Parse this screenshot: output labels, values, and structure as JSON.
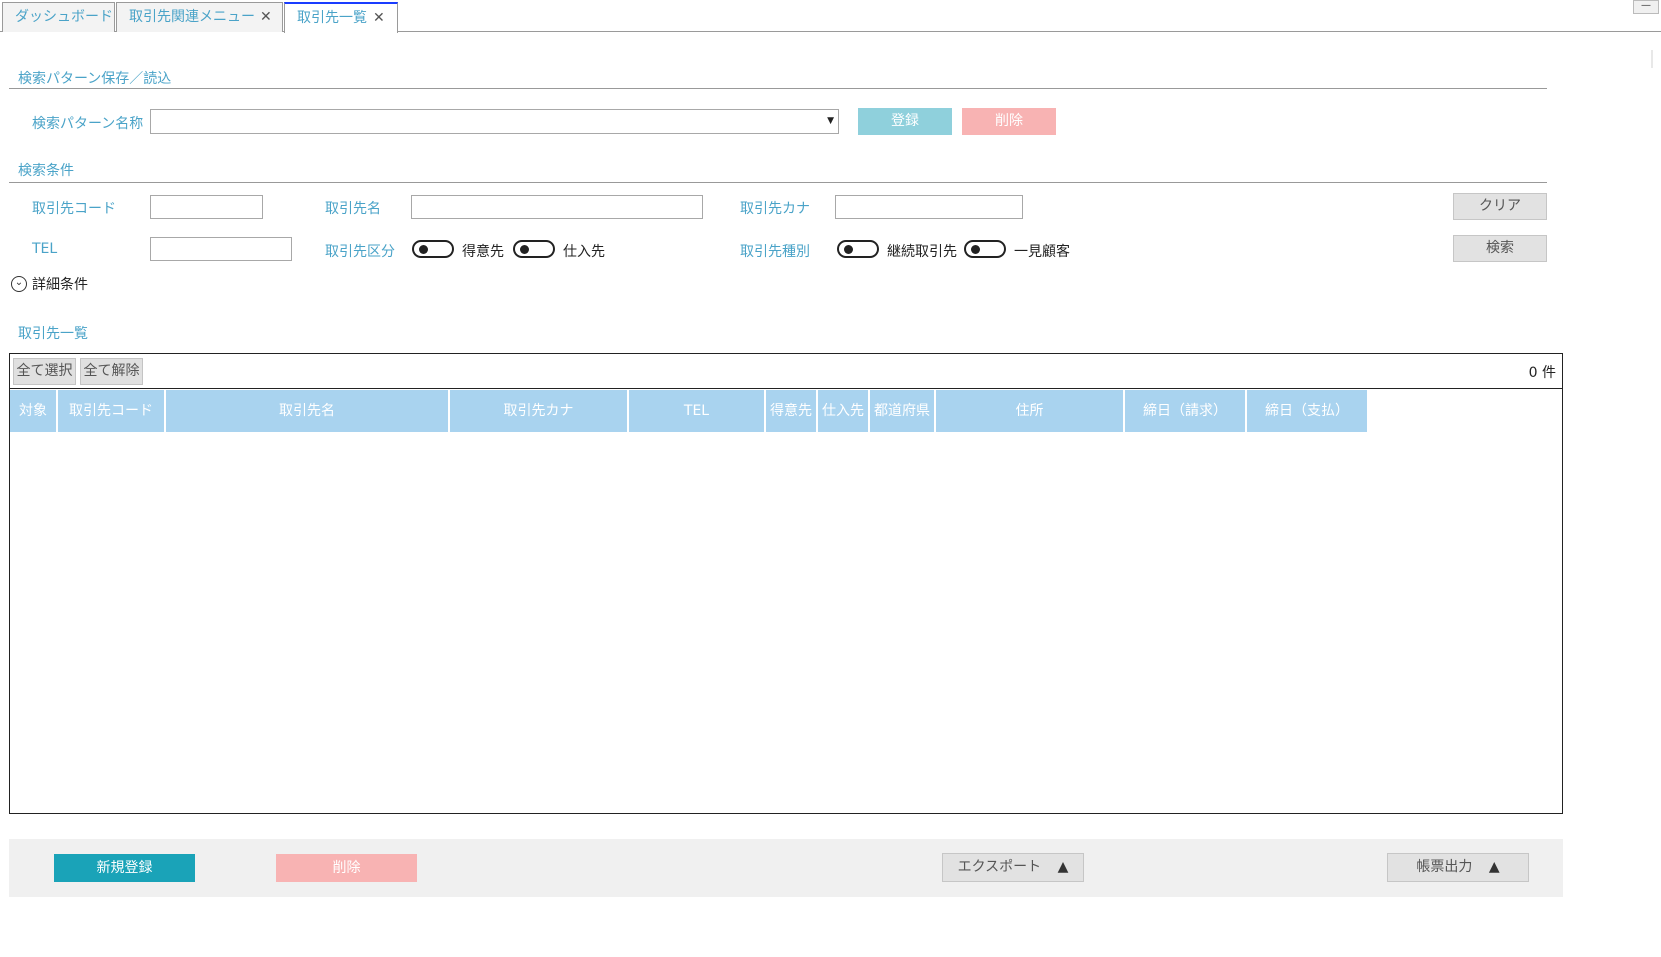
{
  "tabs": [
    {
      "label": "ダッシュボード",
      "closable": false,
      "active": false
    },
    {
      "label": "取引先関連メニュー",
      "closable": true,
      "active": false
    },
    {
      "label": "取引先一覧",
      "closable": true,
      "active": true
    }
  ],
  "close_glyph": "✕",
  "window": {
    "minimize_glyph": "—"
  },
  "pattern_section": {
    "title": "検索パターン保存／読込",
    "name_label": "検索パターン名称",
    "select_value": "",
    "register_button": "登録",
    "delete_button": "削除"
  },
  "conditions_section": {
    "title": "検索条件",
    "code_label": "取引先コード",
    "code_value": "",
    "name_label": "取引先名",
    "name_value": "",
    "kana_label": "取引先カナ",
    "kana_value": "",
    "tel_label": "TEL",
    "tel_value": "",
    "division_label": "取引先区分",
    "division_options": [
      "得意先",
      "仕入先"
    ],
    "type_label": "取引先種別",
    "type_options": [
      "継続取引先",
      "一見顧客"
    ],
    "clear_button": "クリア",
    "search_button": "検索",
    "detail_toggle": "詳細条件"
  },
  "list_section": {
    "title": "取引先一覧",
    "select_all": "全て選択",
    "deselect_all": "全て解除",
    "count": "0 件",
    "columns": [
      "対象",
      "取引先コード",
      "取引先名",
      "取引先カナ",
      "TEL",
      "得意先",
      "仕入先",
      "都道府県",
      "住所",
      "締日（請求）",
      "締日（支払）"
    ],
    "rows": []
  },
  "footer": {
    "new_button": "新規登録",
    "delete_button": "削除",
    "export_button": "エクスポート",
    "report_button": "帳票出力",
    "arrow_glyph": "▲"
  },
  "colors": {
    "accent_text": "#4aa3c8",
    "header_bg": "#a9d3ef",
    "primary_button": "#1aa3b8",
    "danger_button": "#f8b3b3",
    "register_button": "#8fd0dc",
    "active_tab_border": "#1a3cff"
  },
  "icons": {
    "detail_toggle_icon": "chevron-down-circle-icon",
    "select_arrow_icon": "caret-down-icon",
    "close_icon": "close-icon",
    "export_icon": "triangle-up-icon"
  }
}
